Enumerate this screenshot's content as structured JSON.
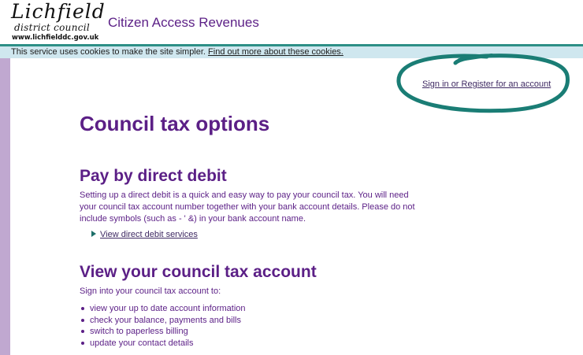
{
  "logo": {
    "line1": "Lichfield",
    "line2": "district council",
    "line3": "www.lichfielddc.gov.uk"
  },
  "header": {
    "title": "Citizen Access Revenues"
  },
  "cookie_bar": {
    "text": "This service uses cookies to make the site simpler.",
    "link": "Find out more about these cookies."
  },
  "account": {
    "signin_label": "Sign in or Register for an account"
  },
  "main": {
    "title": "Council tax options",
    "direct_debit": {
      "heading": "Pay by direct debit",
      "body": "Setting up a direct debit is a quick and easy way to pay your council tax. You will need your council tax account number together with your bank account details. Please do not include symbols (such as - ' &) in your bank account name.",
      "link": "View direct debit services"
    },
    "view_account": {
      "heading": "View your council tax account",
      "intro": "Sign into your council tax account to:",
      "items": [
        "view your up to date account information",
        "check your balance, payments and bills",
        "switch to paperless billing",
        "update your contact details"
      ]
    }
  },
  "colors": {
    "brand_purple": "#5b1f86",
    "teal_rule": "#2d8f86",
    "cookie_bg": "#cfe7ef",
    "side_strip": "#c0a8d0",
    "annotation": "#1a7d75"
  }
}
